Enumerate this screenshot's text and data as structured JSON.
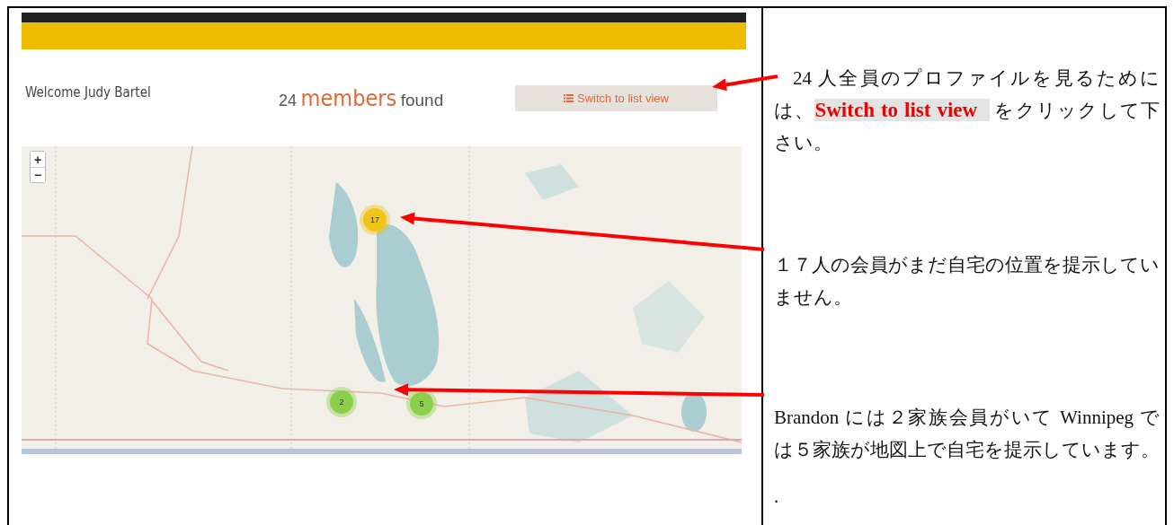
{
  "screenshot": {
    "welcome": "Welcome Judy Bartel",
    "count": "24",
    "count_word": "members",
    "count_suffix": "found",
    "list_button": "Switch to list view",
    "map": {
      "zoom_in": "+",
      "zoom_out": "−",
      "kind": "picture",
      "clusters": [
        {
          "label": "17",
          "color": "#f0c419"
        },
        {
          "label": "2",
          "color": "#8ccf4d"
        },
        {
          "label": "5",
          "color": "#8ccf4d"
        }
      ]
    }
  },
  "notes": [
    {
      "kind": "hint",
      "before": "24 人全員のプロファイルを見るためには、",
      "highlight": "Switch to list view",
      "after": "をクリックして下さい。"
    },
    {
      "kind": "text",
      "text": "１７人の会員がまだ自宅の位置を提示していません。"
    },
    {
      "kind": "text",
      "text": "Brandon には２家族会員がいて Winnipeg では５家族が地図上で自宅を提示しています。"
    },
    {
      "kind": "text",
      "text": "."
    }
  ]
}
